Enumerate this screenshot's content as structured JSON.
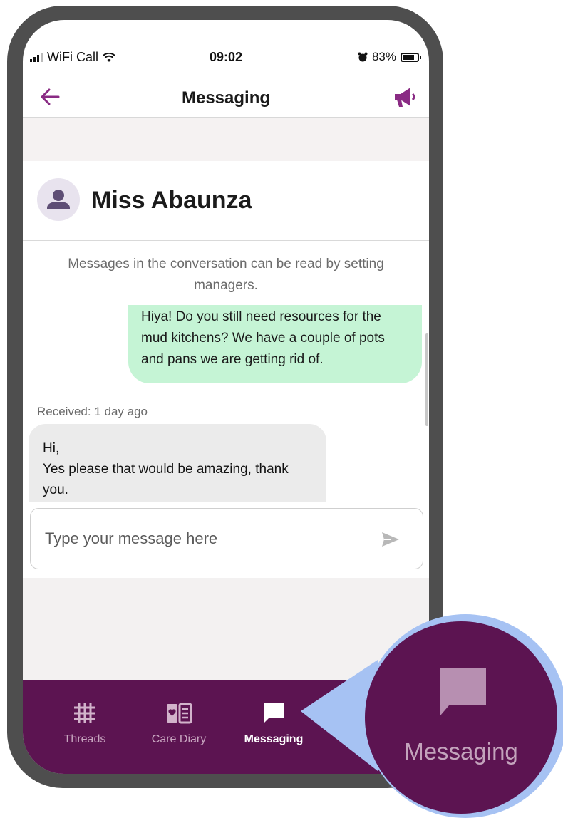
{
  "status_bar": {
    "carrier": "WiFi Call",
    "time": "09:02",
    "battery": "83%"
  },
  "nav": {
    "title": "Messaging"
  },
  "contact": {
    "name": "Miss Abaunza"
  },
  "conversation": {
    "notice": "Messages in the conversation can be read by setting managers.",
    "sent_message": "Hiya! Do you still need resources for the mud kitchens? We have a couple of pots and pans we are getting rid of.",
    "received_time": "Received: 1 day ago",
    "received_line1": "Hi,",
    "received_line2": "Yes please that would be amazing, thank you."
  },
  "composer": {
    "placeholder": "Type your message here",
    "value": ""
  },
  "tabs": [
    {
      "label": "Threads",
      "icon": "threads-grid-icon",
      "active": false
    },
    {
      "label": "Care Diary",
      "icon": "care-diary-icon",
      "active": false
    },
    {
      "label": "Messaging",
      "icon": "message-bubble-icon",
      "active": true
    }
  ],
  "callout": {
    "label": "Messaging",
    "icon": "message-bubble-icon"
  },
  "colors": {
    "brand": "#5c1451",
    "accent": "#8a2b84",
    "sent_bubble": "#c5f4d5",
    "received_bubble": "#ebebeb",
    "callout_ring": "#a6c2f3"
  }
}
